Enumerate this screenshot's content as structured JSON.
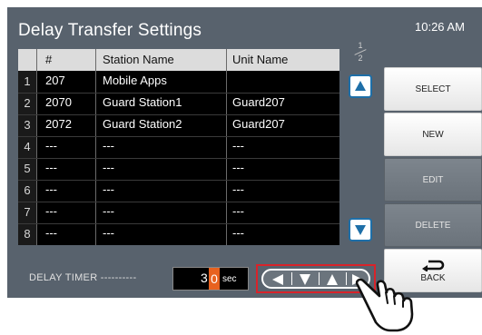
{
  "screen": {
    "title": "Delay Transfer Settings",
    "clock": "10:26 AM"
  },
  "table": {
    "headers": [
      "#",
      "Station Name",
      "Unit Name"
    ],
    "rows": [
      {
        "idx": "1",
        "num": "207",
        "station": "Mobile Apps",
        "unit": ""
      },
      {
        "idx": "2",
        "num": "2070",
        "station": "Guard Station1",
        "unit": "Guard207"
      },
      {
        "idx": "3",
        "num": "2072",
        "station": "Guard Station2",
        "unit": "Guard207"
      },
      {
        "idx": "4",
        "num": "---",
        "station": "---",
        "unit": "---"
      },
      {
        "idx": "5",
        "num": "---",
        "station": "---",
        "unit": "---"
      },
      {
        "idx": "6",
        "num": "---",
        "station": "---",
        "unit": "---"
      },
      {
        "idx": "7",
        "num": "---",
        "station": "---",
        "unit": "---"
      },
      {
        "idx": "8",
        "num": "---",
        "station": "---",
        "unit": "---"
      }
    ]
  },
  "pagination": {
    "current": "1",
    "total": "2"
  },
  "side_buttons": {
    "select": "SELECT",
    "new": "NEW",
    "edit": "EDIT",
    "delete": "DELETE",
    "back": "BACK"
  },
  "delay_timer": {
    "label": "DELAY TIMER ----------",
    "digit_tens": "3",
    "digit_ones": "0",
    "unit": "sec"
  },
  "icons": {
    "scroll_up": "up-triangle-icon",
    "scroll_down": "down-triangle-icon",
    "nav_left": "left-triangle-icon",
    "nav_down": "down-triangle-icon",
    "nav_up": "up-triangle-icon",
    "nav_right": "right-triangle-icon",
    "back": "back-arrow-icon",
    "pointer": "pointing-hand-icon"
  },
  "colors": {
    "background": "#58626d",
    "accent_blue": "#1e6fa8",
    "highlight_orange": "#e8621f",
    "callout_red": "#d9232a"
  }
}
